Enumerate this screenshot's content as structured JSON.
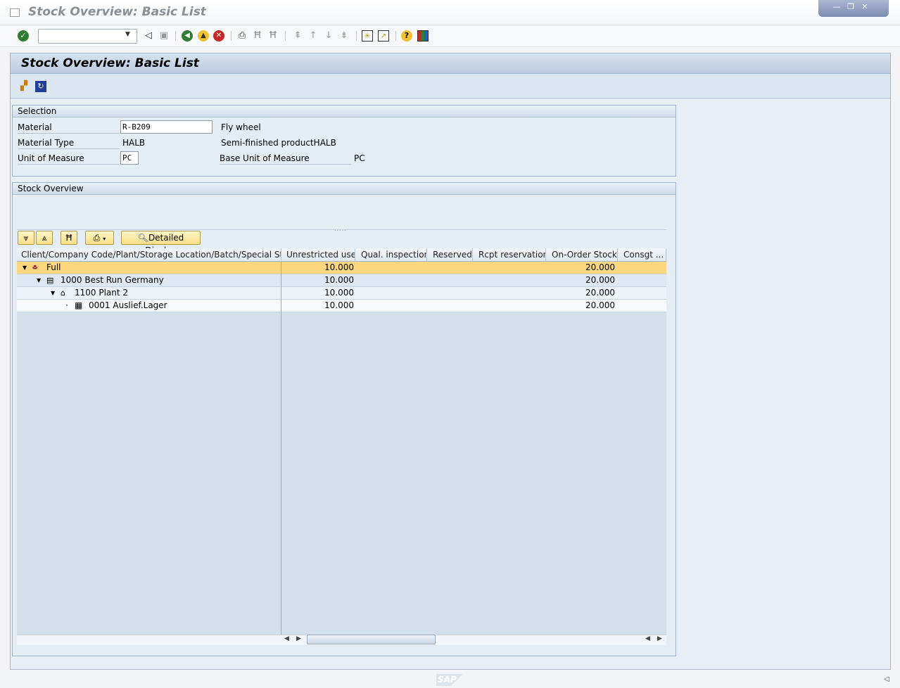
{
  "window": {
    "title": "Stock Overview: Basic List",
    "controls": [
      "minimize",
      "restore",
      "close"
    ]
  },
  "toolbar": {
    "command_field": {
      "value": "",
      "placeholder": ""
    },
    "icons": [
      "enter-icon",
      "back-arrow-icon",
      "save-icon",
      "back-icon",
      "exit-icon",
      "cancel-icon",
      "print-icon",
      "find-icon",
      "find-next-icon",
      "first-page-icon",
      "previous-page-icon",
      "next-page-icon",
      "last-page-icon",
      "create-session-icon",
      "shortcut-icon",
      "help-icon",
      "customize-layout-icon"
    ]
  },
  "page": {
    "title": "Stock Overview: Basic List"
  },
  "app_toolbar": {
    "icons": [
      "hierarchy-icon",
      "refresh-icon"
    ]
  },
  "selection": {
    "title": "Selection",
    "material_label": "Material",
    "material_value": "R-B209",
    "material_desc": "Fly wheel",
    "type_label": "Material Type",
    "type_value": "HALB",
    "type_desc": "Semi-finished productHALB",
    "uom_label": "Unit of Measure",
    "uom_value": "PC",
    "base_uom_label": "Base Unit of Measure",
    "base_uom_value": "PC"
  },
  "stock": {
    "title": "Stock Overview",
    "buttons": {
      "expand": "expand-all-icon",
      "collapse": "collapse-all-icon",
      "find": "find-icon",
      "print": "print-icon",
      "detailed": "Detailed Display"
    },
    "columns": [
      "Client/Company Code/Plant/Storage Location/Batch/Special Stock",
      "Unrestricted use",
      "Qual. inspection",
      "Reserved",
      "Rcpt reservation",
      "On-Order Stock",
      "Consgt ..."
    ],
    "rows": [
      {
        "label": "Full",
        "icon": "client-icon",
        "unrestricted": "10.000",
        "qual": "",
        "reserved": "",
        "rcpt": "",
        "onorder": "20.000",
        "consgt": "",
        "selected": true
      },
      {
        "label": "1000 Best Run Germany",
        "icon": "company-code-icon",
        "unrestricted": "10.000",
        "qual": "",
        "reserved": "",
        "rcpt": "",
        "onorder": "20.000",
        "consgt": ""
      },
      {
        "label": "1100 Plant 2",
        "icon": "plant-icon",
        "unrestricted": "10.000",
        "qual": "",
        "reserved": "",
        "rcpt": "",
        "onorder": "20.000",
        "consgt": ""
      },
      {
        "label": "0001 Auslief.Lager",
        "icon": "storage-location-icon",
        "unrestricted": "10.000",
        "qual": "",
        "reserved": "",
        "rcpt": "",
        "onorder": "20.000",
        "consgt": ""
      }
    ]
  },
  "footer": {
    "logo": "SAP"
  },
  "colors": {
    "selected_row": "#fcd77f",
    "header_gradient": "#b9cbe0",
    "button_yellow": "#f8de86"
  }
}
